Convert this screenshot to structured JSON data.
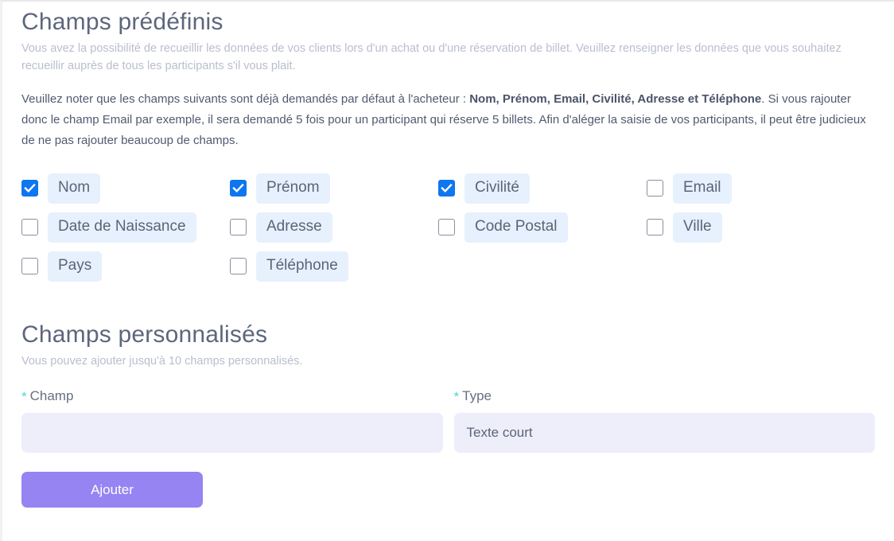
{
  "predefined": {
    "title": "Champs prédéfinis",
    "subtitle": "Vous avez la possibilité de recueillir les données de vos clients lors d'un achat ou d'une réservation de billet. Veuillez renseigner les données que vous souhaitez recueillir auprès de tous les participants s'il vous plait.",
    "note_part1": "Veuillez noter que les champs suivants sont déjà demandés par défaut à l'acheteur : ",
    "note_bold": "Nom, Prénom, Email, Civilité, Adresse et Téléphone",
    "note_part2": ". Si vous rajouter donc le champ Email par exemple, il sera demandé 5 fois pour un participant qui réserve 5 billets. Afin d'aléger la saisie de vos participants, il peut être judicieux de ne pas rajouter beaucoup de champs.",
    "fields": [
      {
        "label": "Nom",
        "checked": true
      },
      {
        "label": "Prénom",
        "checked": true
      },
      {
        "label": "Civilité",
        "checked": true
      },
      {
        "label": "Email",
        "checked": false
      },
      {
        "label": "Date de Naissance",
        "checked": false
      },
      {
        "label": "Adresse",
        "checked": false
      },
      {
        "label": "Code Postal",
        "checked": false
      },
      {
        "label": "Ville",
        "checked": false
      },
      {
        "label": "Pays",
        "checked": false
      },
      {
        "label": "Téléphone",
        "checked": false
      },
      {
        "label": "",
        "checked": null
      },
      {
        "label": "",
        "checked": null
      }
    ]
  },
  "custom": {
    "title": "Champs personnalisés",
    "subtitle": "Vous pouvez ajouter jusqu'à 10 champs personnalisés.",
    "champ_label": "Champ",
    "champ_value": "",
    "champ_placeholder": "",
    "type_label": "Type",
    "type_value": "Texte court",
    "required_marker": "*",
    "add_button": "Ajouter"
  },
  "colors": {
    "accent_purple": "#9584f2",
    "checkbox_blue": "#0d76f0",
    "pill_blue": "#e6f1fd",
    "input_lavender": "#eeeefa",
    "required_teal": "#4fd3d8",
    "heading_slate": "#5d667c"
  }
}
